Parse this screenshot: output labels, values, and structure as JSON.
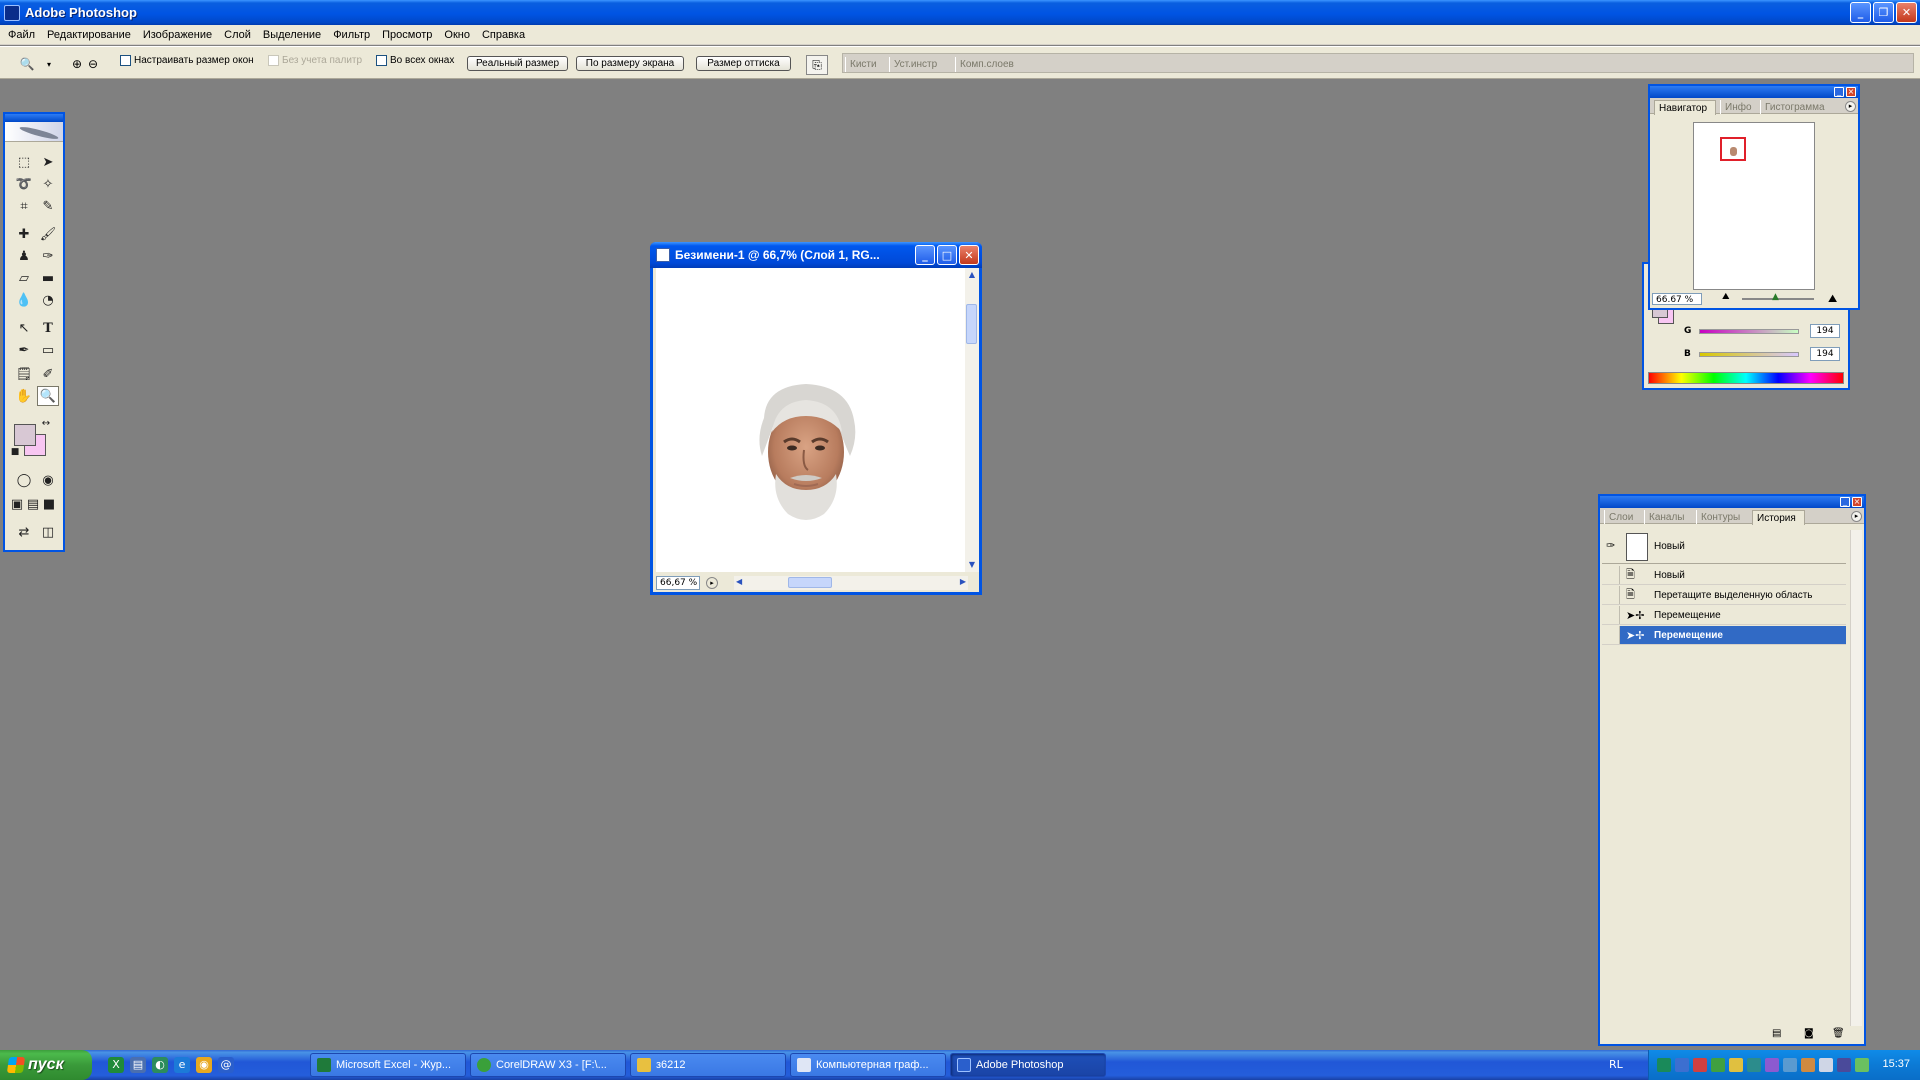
{
  "app": {
    "title": "Adobe Photoshop"
  },
  "menu": [
    "Файл",
    "Редактирование",
    "Изображение",
    "Слой",
    "Выделение",
    "Фильтр",
    "Просмотр",
    "Окно",
    "Справка"
  ],
  "options": {
    "resize_windows": "Настраивать размер окон",
    "ignore_palettes": "Без учета палитр",
    "all_windows": "Во всех окнах",
    "actual_pixels": "Реальный размер",
    "fit_screen": "По размеру экрана",
    "print_size": "Размер оттиска"
  },
  "palette_well": [
    "Кисти",
    "Уст.инстр",
    "Комп.слоев"
  ],
  "document": {
    "title": "Безимени-1 @ 66,7% (Слой 1, RG...",
    "zoom": "66,67 %"
  },
  "navigator": {
    "tabs": [
      "Навигатор",
      "Инфо",
      "Гистограмма"
    ],
    "zoom": "66.67 %"
  },
  "color": {
    "rows": [
      {
        "label": "G",
        "value": "194"
      },
      {
        "label": "B",
        "value": "194"
      }
    ],
    "foreground": "#d8c8d4",
    "background": "#f8c6f2"
  },
  "history": {
    "tabs": [
      "Слои",
      "Каналы",
      "Контуры",
      "История"
    ],
    "snapshot": "Новый",
    "items": [
      {
        "label": "Новый",
        "icon": "new-doc-icon"
      },
      {
        "label": "Перетащите выделенную область",
        "icon": "drag-selection-icon"
      },
      {
        "label": "Перемещение",
        "icon": "move-icon"
      },
      {
        "label": "Перемещение",
        "icon": "move-icon",
        "selected": true
      }
    ]
  },
  "taskbar": {
    "start": "пуск",
    "tasks": [
      {
        "label": "Microsoft Excel - Жур...",
        "color": "#1f7a3a"
      },
      {
        "label": "CorelDRAW X3 - [F:\\...",
        "color": "#3aa03a"
      },
      {
        "label": "з6212",
        "color": "#e8c040"
      },
      {
        "label": "Компьютерная граф...",
        "color": "#dfe6f5"
      },
      {
        "label": "Adobe Photoshop",
        "color": "#2a5fcc",
        "active": true
      }
    ],
    "lang": "RL",
    "clock": "15:37"
  },
  "colors": {
    "xp_blue": "#0054e3",
    "workspace": "#808080",
    "selection": "#316ac5"
  }
}
